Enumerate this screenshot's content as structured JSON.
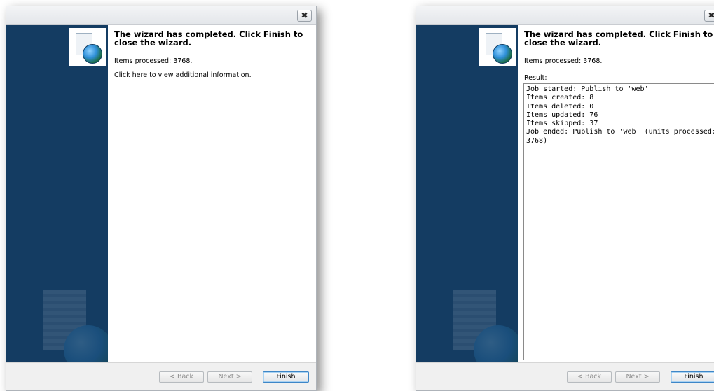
{
  "dialogs": [
    {
      "heading": "The wizard has completed. Click Finish to close the wizard.",
      "items_processed": "Items processed: 3768.",
      "info_link": "Click here to view additional information.",
      "buttons": {
        "back": "< Back",
        "next": "Next >",
        "finish": "Finish"
      }
    },
    {
      "heading": "The wizard has completed. Click Finish to close the wizard.",
      "items_processed": "Items processed: 3768.",
      "result_label": "Result:",
      "result_text": "Job started: Publish to 'web'\nItems created: 8\nItems deleted: 0\nItems updated: 76\nItems skipped: 37\nJob ended: Publish to 'web' (units processed: 3768)",
      "buttons": {
        "back": "< Back",
        "next": "Next >",
        "finish": "Finish"
      }
    }
  ],
  "icons": {
    "close": "close-icon",
    "wizard_logo": "publish-globe-icon"
  },
  "colors": {
    "side_panel": "#143c62",
    "finish_border": "#3d86c7"
  }
}
